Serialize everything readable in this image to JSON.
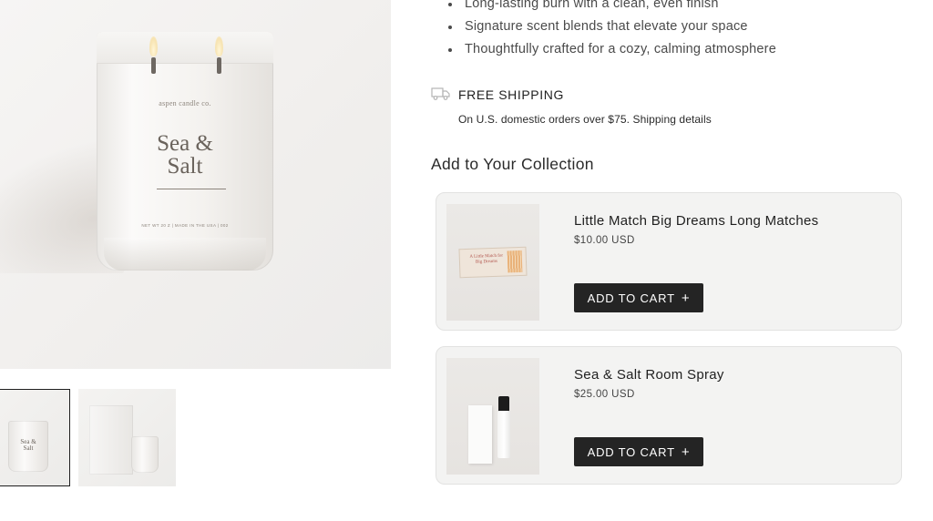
{
  "product": {
    "bullets": [
      "Long-lasting burn with a clean, even finish",
      "Signature scent blends that elevate your space",
      "Thoughtfully crafted for a cozy, calming atmosphere"
    ],
    "image": {
      "brand_text": "aspen candle co.",
      "name_line1": "Sea &",
      "name_line2": "Salt",
      "fine_print": "NET WT 20 Z  |  MADE IN THE USA  |  002"
    },
    "thumbnails": [
      {
        "label_line1": "Sea &",
        "label_line2": "Salt",
        "selected": true
      },
      {
        "label_line1": "",
        "label_line2": "",
        "selected": false
      }
    ]
  },
  "shipping": {
    "icon": "truck-icon",
    "title": "FREE SHIPPING",
    "subtitle": "On U.S. domestic orders over $75.",
    "link": "Shipping details"
  },
  "collection": {
    "title": "Add to Your Collection",
    "items": [
      {
        "title": "Little Match Big Dreams Long Matches",
        "price": "$10.00 USD",
        "button": "ADD TO CART",
        "image_text": "A Little Match for Big Dreams"
      },
      {
        "title": "Sea & Salt Room Spray",
        "price": "$25.00 USD",
        "button": "ADD TO CART"
      }
    ]
  },
  "colors": {
    "button_bg": "#242424",
    "card_bg": "#f3f3f2",
    "text": "#1f1f1f"
  }
}
